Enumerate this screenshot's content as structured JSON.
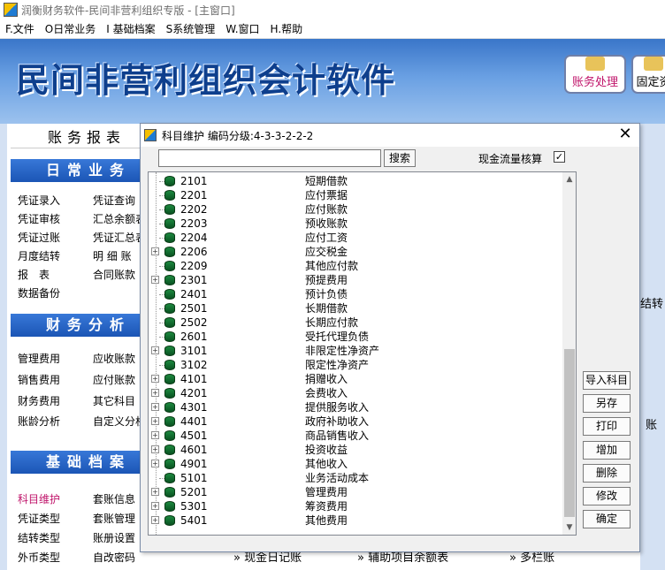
{
  "window": {
    "title": "润衡财务软件-民间非营利组织专版 - [主窗口]"
  },
  "menu": [
    "F.文件",
    "O日常业务",
    "I 基础档案",
    "S系统管理",
    "W.窗口",
    "H.帮助"
  ],
  "banner": {
    "title": "民间非营利组织会计软件",
    "btn_accounting": "账务处理",
    "btn_fixed": "固定资"
  },
  "left": {
    "report_head": "账务报表",
    "daily_head": "日常业务",
    "daily_col1": [
      "凭证录入",
      "凭证审核",
      "凭证过账",
      "月度结转",
      "报　表",
      "数据备份"
    ],
    "daily_col2": [
      "凭证查询",
      "汇总余额表",
      "凭证汇总表",
      "明 细 账",
      "合同账款"
    ],
    "analysis_head": "财务分析",
    "analysis_col1": [
      "管理费用",
      "销售费用",
      "财务费用",
      "账龄分析"
    ],
    "analysis_col2": [
      "应收账款",
      "应付账款",
      "其它科目",
      "自定义分析"
    ],
    "base_head": "基础档案",
    "base_col1": [
      "科目维护",
      "凭证类型",
      "结转类型",
      "外币类型"
    ],
    "base_col2": [
      "套账信息",
      "套账管理",
      "账册设置",
      "自改密码"
    ]
  },
  "right_labels": {
    "jiezhuan": "结转",
    "zhang": "账"
  },
  "bottom_links": [
    "» 现金日记账",
    "» 辅助项目余额表",
    "» 多栏账"
  ],
  "dialog": {
    "title": "科目维护  编码分级:4-3-3-2-2-2",
    "close": "✕",
    "search_placeholder": "",
    "search_btn": "搜索",
    "cashflow_label": "现金流量核算",
    "cashflow_checked": "✓",
    "rows": [
      {
        "code": "2101",
        "name": "短期借款",
        "expandable": false
      },
      {
        "code": "2201",
        "name": "应付票据",
        "expandable": false
      },
      {
        "code": "2202",
        "name": "应付账款",
        "expandable": false
      },
      {
        "code": "2203",
        "name": "预收账款",
        "expandable": false
      },
      {
        "code": "2204",
        "name": "应付工资",
        "expandable": false
      },
      {
        "code": "2206",
        "name": "应交税金",
        "expandable": true
      },
      {
        "code": "2209",
        "name": "其他应付款",
        "expandable": false
      },
      {
        "code": "2301",
        "name": "预提费用",
        "expandable": true
      },
      {
        "code": "2401",
        "name": "预计负债",
        "expandable": false
      },
      {
        "code": "2501",
        "name": "长期借款",
        "expandable": false
      },
      {
        "code": "2502",
        "name": "长期应付款",
        "expandable": false
      },
      {
        "code": "2601",
        "name": "受托代理负债",
        "expandable": false
      },
      {
        "code": "3101",
        "name": "非限定性净资产",
        "expandable": true
      },
      {
        "code": "3102",
        "name": "限定性净资产",
        "expandable": false
      },
      {
        "code": "4101",
        "name": "捐赠收入",
        "expandable": true
      },
      {
        "code": "4201",
        "name": "会费收入",
        "expandable": true
      },
      {
        "code": "4301",
        "name": "提供服务收入",
        "expandable": true
      },
      {
        "code": "4401",
        "name": "政府补助收入",
        "expandable": true
      },
      {
        "code": "4501",
        "name": "商品销售收入",
        "expandable": true
      },
      {
        "code": "4601",
        "name": "投资收益",
        "expandable": true
      },
      {
        "code": "4901",
        "name": "其他收入",
        "expandable": true
      },
      {
        "code": "5101",
        "name": "业务活动成本",
        "expandable": false
      },
      {
        "code": "5201",
        "name": "管理费用",
        "expandable": true
      },
      {
        "code": "5301",
        "name": "筹资费用",
        "expandable": true
      },
      {
        "code": "5401",
        "name": "其他费用",
        "expandable": true
      }
    ],
    "buttons": [
      "导入科目",
      "另存",
      "打印",
      "增加",
      "删除",
      "修改",
      "确定"
    ]
  }
}
